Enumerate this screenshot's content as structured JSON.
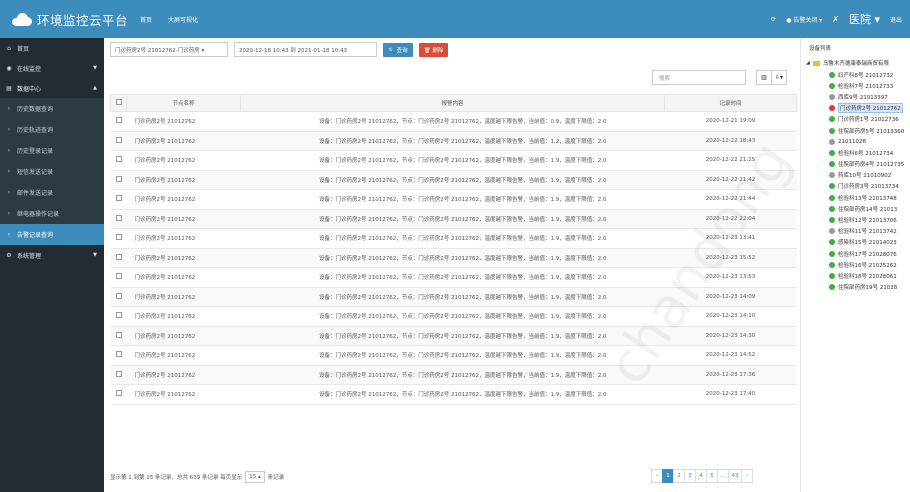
{
  "header": {
    "app_title": "环境监控云平台",
    "nav": [
      "首页",
      "大屏可视化"
    ],
    "alarm_label": "● 告警关闭 ▾",
    "user": "医院 ▾",
    "logout": "退出",
    "brand_color": "#3c8dbc"
  },
  "sidebar": {
    "items": [
      {
        "icon": "home-icon",
        "glyph": "⌂",
        "label": "首页"
      },
      {
        "icon": "monitor-icon",
        "glyph": "◉",
        "label": "在线监控",
        "caret": "▼"
      },
      {
        "icon": "data-icon",
        "glyph": "▤",
        "label": "数据中心",
        "caret": "▲"
      }
    ],
    "sub_items": [
      {
        "label": "历史数据查询",
        "active": false
      },
      {
        "label": "历史轨迹查询",
        "active": false
      },
      {
        "label": "历史登录记录",
        "active": false
      },
      {
        "label": "短信发送记录",
        "active": false
      },
      {
        "label": "邮件发送记录",
        "active": false
      },
      {
        "label": "继电器操作记录",
        "active": false
      },
      {
        "label": "告警记录查询",
        "active": true
      }
    ],
    "system": {
      "icon": "gear-icon",
      "glyph": "⚙",
      "label": "系统管理",
      "caret": "▼"
    }
  },
  "toolbar": {
    "device_select": "门诊药房2号 21012762-门诊药房 ▾",
    "date_range": "2020-12-18 10:43 到 2021-01-18 10:43",
    "query_label": "🔍 查询",
    "delete_label": "🗑 删除"
  },
  "search": {
    "placeholder": "搜索"
  },
  "table": {
    "headers": [
      "",
      "节点名称",
      "报警内容",
      "记录时间"
    ],
    "rows": [
      {
        "node": "门诊药房2号 21012762",
        "content": "设备：门诊药房2号 21012762，节点：门诊药房2号 21012762，温度越下限告警，当前值：0.9，温度下限值：2.0",
        "time": "2020-12-21 19:09"
      },
      {
        "node": "门诊药房2号 21012762",
        "content": "设备：门诊药房2号 21012762，节点：门诊药房2号 21012762，温度越下限告警，当前值：1.2，温度下限值：2.0",
        "time": "2020-12-22 18:43"
      },
      {
        "node": "门诊药房2号 21012762",
        "content": "设备：门诊药房2号 21012762，节点：门诊药房2号 21012762，温度越下限告警，当前值：1.9，温度下限值：2.0",
        "time": "2020-12-22 21:25"
      },
      {
        "node": "门诊药房2号 21012762",
        "content": "设备：门诊药房2号 21012762，节点：门诊药房2号 21012762，温度越下限告警，当前值：1.9，温度下限值：2.0",
        "time": "2020-12-22 21:42"
      },
      {
        "node": "门诊药房2号 21012762",
        "content": "设备：门诊药房2号 21012762，节点：门诊药房2号 21012762，温度越下限告警，当前值：1.9，温度下限值：2.0",
        "time": "2020-12-22 21:44"
      },
      {
        "node": "门诊药房2号 21012762",
        "content": "设备：门诊药房2号 21012762，节点：门诊药房2号 21012762，温度越下限告警，当前值：1.9，温度下限值：2.0",
        "time": "2020-12-22 22:04"
      },
      {
        "node": "门诊药房2号 21012762",
        "content": "设备：门诊药房2号 21012762，节点：门诊药房2号 21012762，温度越下限告警，当前值：1.9，温度下限值：2.0",
        "time": "2020-12-23 13:41"
      },
      {
        "node": "门诊药房2号 21012762",
        "content": "设备：门诊药房2号 21012762，节点：门诊药房2号 21012762，温度越下限告警，当前值：1.9，温度下限值：2.0",
        "time": "2020-12-23 15:52"
      },
      {
        "node": "门诊药房2号 21012762",
        "content": "设备：门诊药房2号 21012762，节点：门诊药房2号 21012762，温度越下限告警，当前值：1.9，温度下限值：2.0",
        "time": "2020-12-23 13:53"
      },
      {
        "node": "门诊药房2号 21012762",
        "content": "设备：门诊药房2号 21012762，节点：门诊药房2号 21012762，温度越下限告警，当前值：1.9，温度下限值：2.0",
        "time": "2020-12-23 14:09"
      },
      {
        "node": "门诊药房2号 21012762",
        "content": "设备：门诊药房2号 21012762，节点：门诊药房2号 21012762，温度越下限告警，当前值：1.9，温度下限值：2.0",
        "time": "2020-12-23 14:10"
      },
      {
        "node": "门诊药房2号 21012762",
        "content": "设备：门诊药房2号 21012762，节点：门诊药房2号 21012762，温度越下限告警，当前值：1.9，温度下限值：2.0",
        "time": "2020-12-23 14:30"
      },
      {
        "node": "门诊药房2号 21012762",
        "content": "设备：门诊药房2号 21012762，节点：门诊药房2号 21012762，温度越下限告警，当前值：1.9，温度下限值：2.0",
        "time": "2020-12-23 14:52"
      },
      {
        "node": "门诊药房2号 21012762",
        "content": "设备：门诊药房2号 21012762，节点：门诊药房2号 21012762，温度越下限告警，当前值：1.9，温度下限值：2.0",
        "time": "2020-12-23 17:36"
      },
      {
        "node": "门诊药房2号 21012762",
        "content": "设备：门诊药房2号 21012762，节点：门诊药房2号 21012762，温度越下限告警，当前值：1.9，温度下限值：2.0",
        "time": "2020-12-23 17:40"
      }
    ]
  },
  "pagination": {
    "info_prefix": "显示第 1 到第 15 条记录，总共 639 条记录 每页显示",
    "page_size": "15 ▴",
    "info_suffix": "条记录",
    "pages": [
      "‹",
      "1",
      "2",
      "3",
      "4",
      "5",
      "...",
      "43",
      "›"
    ],
    "current": "1"
  },
  "device_panel": {
    "title": "设备列表",
    "root": "乌鲁木齐德康泰瑞商贸有限",
    "devices": [
      {
        "name": "妇产科8号 21012732",
        "status": "online"
      },
      {
        "name": "检验科7号 21012733",
        "status": "online"
      },
      {
        "name": "西库9号 21013397",
        "status": "offline"
      },
      {
        "name": "门诊药房2号 21012762",
        "status": "alarm",
        "selected": true
      },
      {
        "name": "门诊药房1号 21012736",
        "status": "online"
      },
      {
        "name": "住院部药房5号 21013360",
        "status": "online"
      },
      {
        "name": "21011028",
        "status": "offline"
      },
      {
        "name": "检验科6号 21012734",
        "status": "online"
      },
      {
        "name": "住院部药房4号 21012735",
        "status": "online"
      },
      {
        "name": "药库10号 21010902",
        "status": "offline"
      },
      {
        "name": "门诊药房3号 21013734",
        "status": "online"
      },
      {
        "name": "检验科13号 21013748",
        "status": "online"
      },
      {
        "name": "住院部药房14号 21013",
        "status": "online"
      },
      {
        "name": "检验科12号 21013706",
        "status": "online"
      },
      {
        "name": "检验科11号 21013742",
        "status": "offline"
      },
      {
        "name": "感染科15号 21014023",
        "status": "online"
      },
      {
        "name": "检验科17号 21028076",
        "status": "online"
      },
      {
        "name": "检验科16号 21025262",
        "status": "online"
      },
      {
        "name": "检验科18号 21028061",
        "status": "online"
      },
      {
        "name": "住院部药房19号 21028",
        "status": "online"
      }
    ],
    "status_colors": {
      "online": "#3cb043",
      "offline": "#999999",
      "alarm": "#e53935"
    }
  },
  "watermark": "chandong"
}
